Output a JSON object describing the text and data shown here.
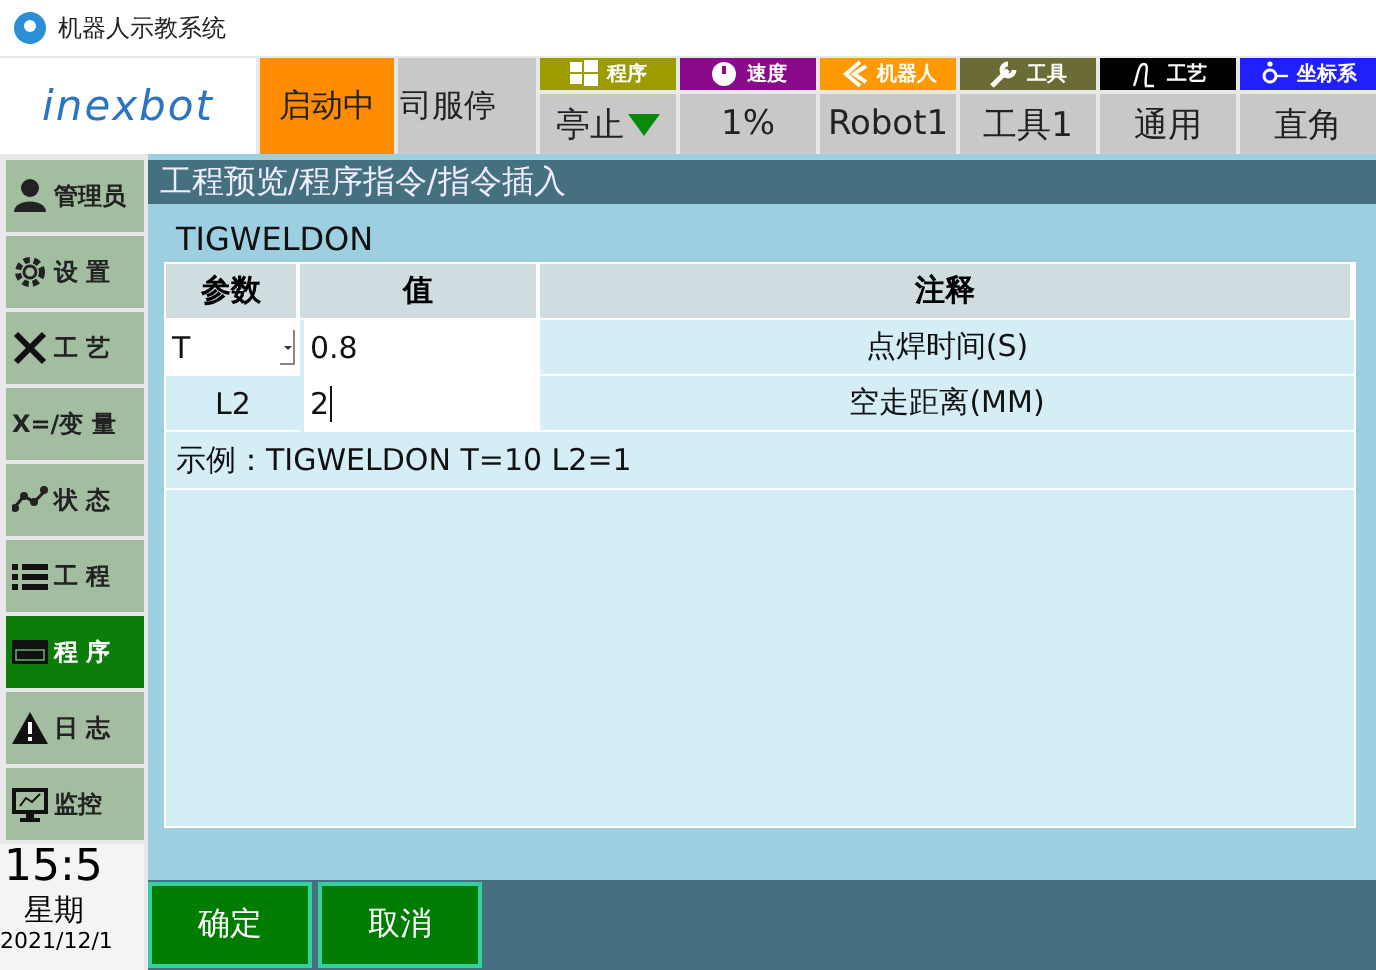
{
  "window": {
    "title": "机器人示教系统"
  },
  "header": {
    "logo": "inexbot",
    "run_state": "启动中",
    "servo_state": "司服停",
    "status": [
      {
        "label": "程序",
        "value": "亭止",
        "color": "#9c9c00",
        "kind": "windows",
        "dropdown": true
      },
      {
        "label": "速度",
        "value": "1%",
        "color": "#8b0a8b",
        "kind": "gauge",
        "dropdown": false
      },
      {
        "label": "机器人",
        "value": "Robot1",
        "color": "#ff9900",
        "kind": "arm",
        "dropdown": false
      },
      {
        "label": "工具",
        "value": "工具1",
        "color": "#6b6b35",
        "kind": "wrench",
        "dropdown": false
      },
      {
        "label": "工艺",
        "value": "通用",
        "color": "#000000",
        "kind": "curve",
        "dropdown": false
      },
      {
        "label": "坐标系",
        "value": "直角",
        "color": "#2020ff",
        "kind": "axis",
        "dropdown": false
      }
    ]
  },
  "sidebar": {
    "items": [
      {
        "label": "管理员",
        "kind": "user",
        "selected": false
      },
      {
        "label": "设 置",
        "kind": "gear",
        "selected": false
      },
      {
        "label": "工 艺",
        "kind": "tools",
        "selected": false
      },
      {
        "label": "X=/变 量",
        "kind": "variable",
        "selected": false
      },
      {
        "label": "状 态",
        "kind": "chart",
        "selected": false
      },
      {
        "label": "工 程",
        "kind": "list",
        "selected": false
      },
      {
        "label": "程 序",
        "kind": "code",
        "selected": true
      },
      {
        "label": "日 志",
        "kind": "warning",
        "selected": false
      },
      {
        "label": "监控",
        "kind": "monitor",
        "selected": false
      }
    ],
    "clock": {
      "time": "15:5",
      "weekday": "星期",
      "date": "2021/12/1"
    }
  },
  "main": {
    "breadcrumb": "工程预览/程序指令/指令插入",
    "instruction": "TIGWELDON",
    "table": {
      "columns": [
        "参数",
        "值",
        "注释"
      ],
      "rows": [
        {
          "param": "T",
          "kind": "dropdown",
          "value": "0.8",
          "focused": false,
          "comment": "点焊时间(S)"
        },
        {
          "param": "L2",
          "kind": "text",
          "value": "2",
          "focused": true,
          "comment": "空走距离(MM)"
        }
      ]
    },
    "example": "示例：TIGWELDON T=10 L2=1"
  },
  "buttons": [
    "确定",
    "取消"
  ]
}
